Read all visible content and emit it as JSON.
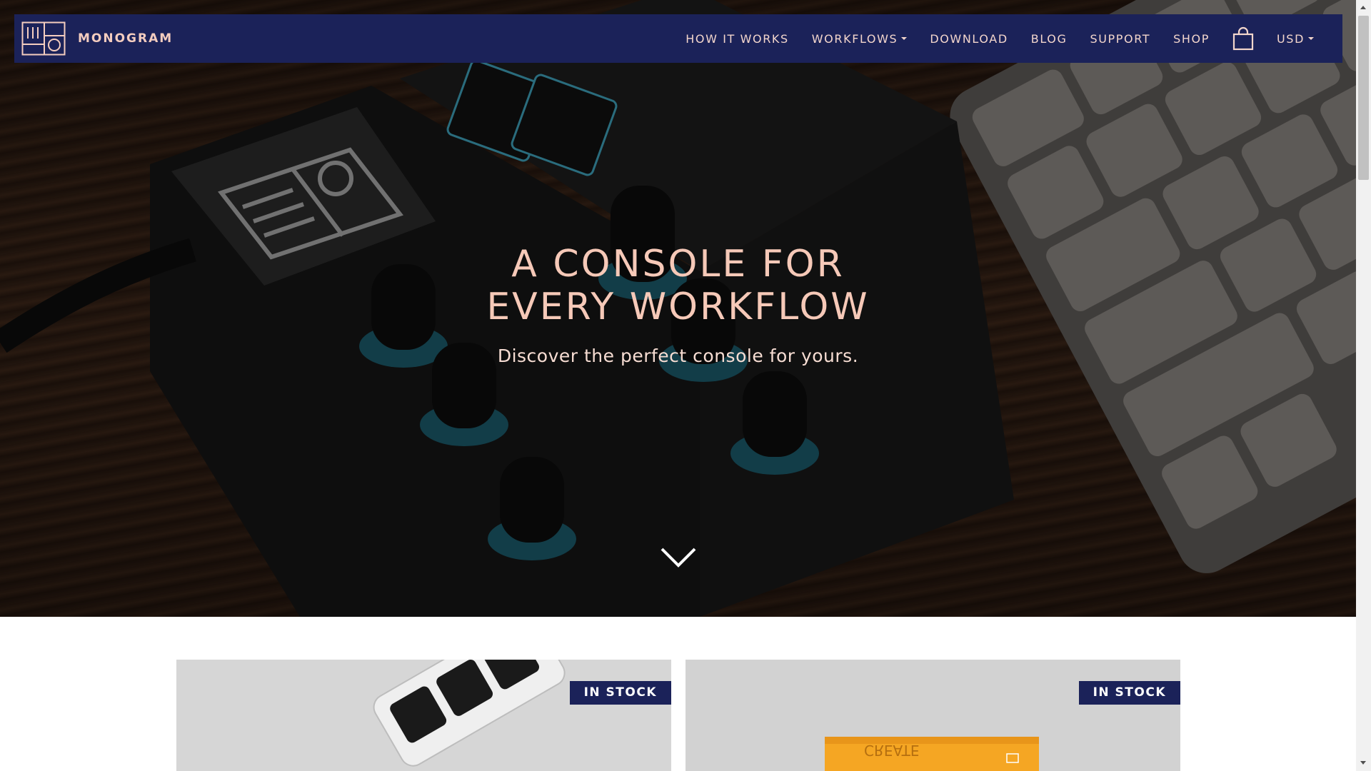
{
  "brand": {
    "name": "MONOGRAM"
  },
  "nav": {
    "items": [
      {
        "label": "HOW IT WORKS",
        "has_dropdown": false
      },
      {
        "label": "WORKFLOWS",
        "has_dropdown": true
      },
      {
        "label": "DOWNLOAD",
        "has_dropdown": false
      },
      {
        "label": "BLOG",
        "has_dropdown": false
      },
      {
        "label": "SUPPORT",
        "has_dropdown": false
      },
      {
        "label": "SHOP",
        "has_dropdown": false
      }
    ],
    "cart_icon": "shopping-bag-icon",
    "currency": "USD"
  },
  "hero": {
    "title_line1": "A CONSOLE FOR",
    "title_line2": "EVERY WORKFLOW",
    "subtitle": "Discover the perfect console for yours.",
    "scroll_icon": "chevron-down-icon"
  },
  "products": [
    {
      "badge": "IN STOCK"
    },
    {
      "badge": "IN STOCK"
    }
  ],
  "colors": {
    "nav_bg": "#1b2259",
    "accent_text": "#f6c9b8",
    "badge_bg": "#1b2259"
  }
}
